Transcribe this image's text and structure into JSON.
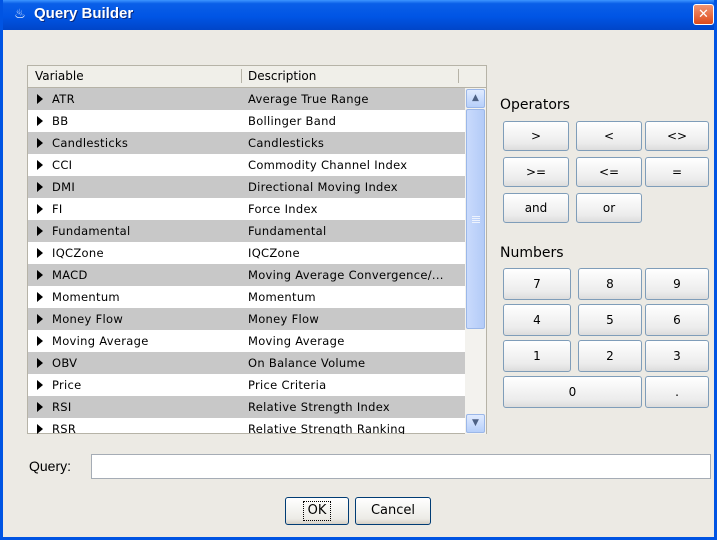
{
  "window": {
    "title": "Query Builder",
    "icon": "java-cup-icon",
    "close_label": "✕"
  },
  "table": {
    "columns": [
      "Variable",
      "Description"
    ],
    "rows": [
      {
        "name": "ATR",
        "description": "Average True Range"
      },
      {
        "name": "BB",
        "description": "Bollinger Band"
      },
      {
        "name": "Candlesticks",
        "description": "Candlesticks"
      },
      {
        "name": "CCI",
        "description": "Commodity Channel Index"
      },
      {
        "name": "DMI",
        "description": "Directional Moving Index"
      },
      {
        "name": "FI",
        "description": "Force Index"
      },
      {
        "name": "Fundamental",
        "description": "Fundamental"
      },
      {
        "name": "IQCZone",
        "description": "IQCZone"
      },
      {
        "name": "MACD",
        "description": "Moving Average Convergence/..."
      },
      {
        "name": "Momentum",
        "description": "Momentum"
      },
      {
        "name": "Money Flow",
        "description": "Money Flow"
      },
      {
        "name": "Moving Average",
        "description": "Moving Average"
      },
      {
        "name": "OBV",
        "description": "On Balance Volume"
      },
      {
        "name": "Price",
        "description": "Price Criteria"
      },
      {
        "name": "RSI",
        "description": "Relative Strength Index"
      },
      {
        "name": "RSR",
        "description": "Relative Strength Ranking"
      }
    ]
  },
  "operators": {
    "label": "Operators",
    "buttons": [
      ">",
      "<",
      "<>",
      ">=",
      "<=",
      "=",
      "and",
      "or"
    ]
  },
  "numbers": {
    "label": "Numbers",
    "buttons": [
      "7",
      "8",
      "9",
      "4",
      "5",
      "6",
      "1",
      "2",
      "3",
      "0",
      "."
    ]
  },
  "query": {
    "label": "Query:",
    "value": "",
    "placeholder": ""
  },
  "dialog_buttons": {
    "ok": "OK",
    "cancel": "Cancel"
  },
  "colors": {
    "title_bar": "#0055e5",
    "alt_row": "#c8c8c8",
    "close_button": "#de4a1b",
    "scrollbar": "#b3cbf7"
  }
}
